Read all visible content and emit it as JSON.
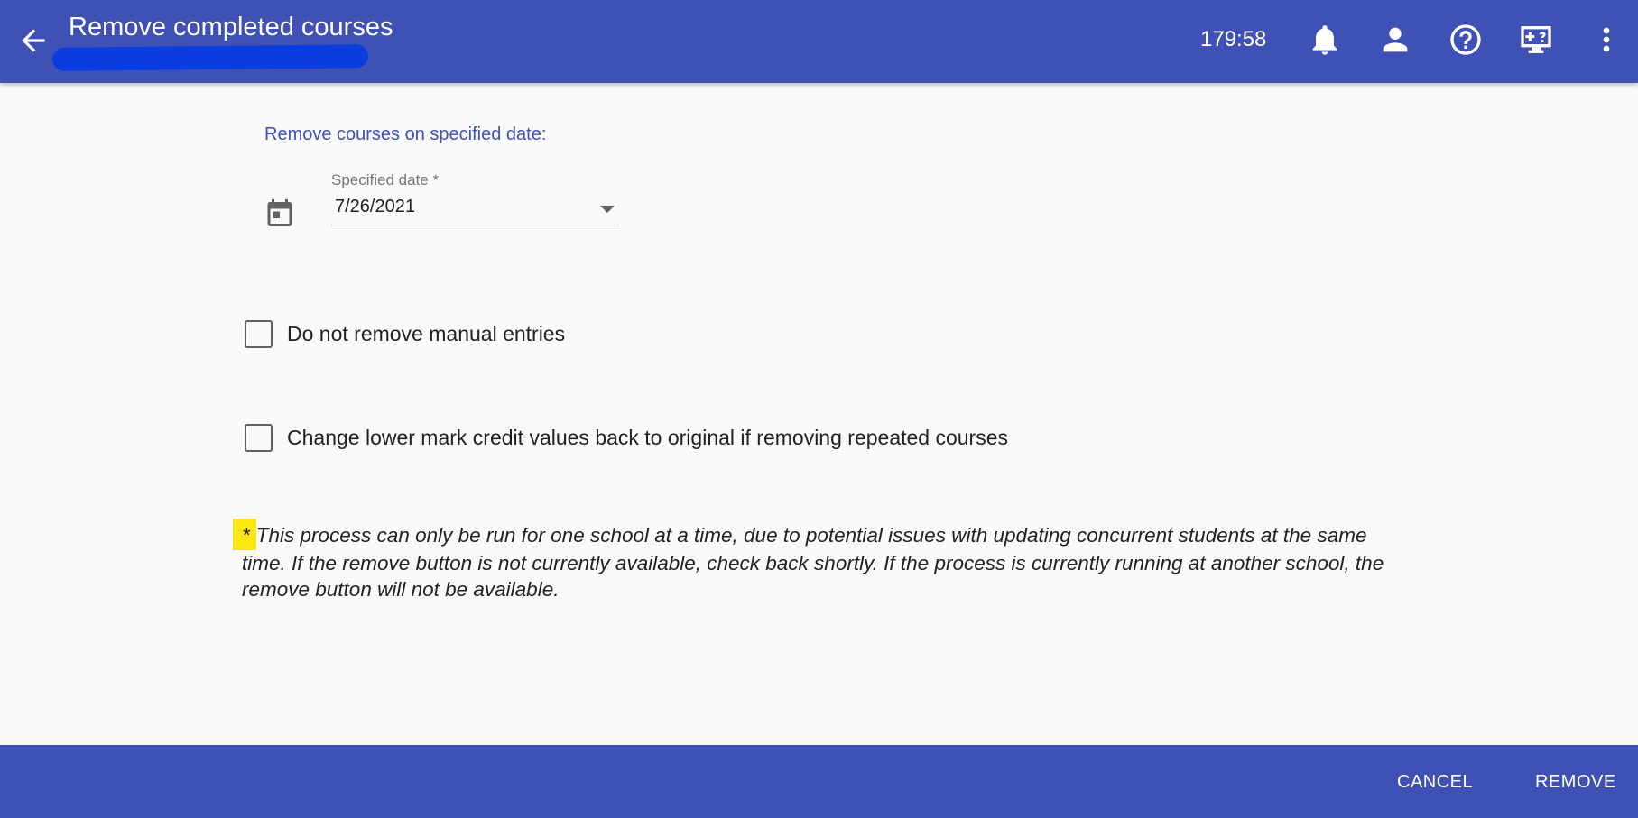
{
  "header": {
    "title": "Remove completed courses",
    "timer": "179:58",
    "icons": [
      "back-arrow-icon",
      "bell-icon",
      "person-icon",
      "help-circle-icon",
      "screen-help-icon",
      "more-vert-icon"
    ]
  },
  "form": {
    "section_label": "Remove courses on specified date:",
    "date_field": {
      "label": "Specified date *",
      "value": "7/26/2021"
    },
    "checkboxes": [
      {
        "label": "Do not remove manual entries",
        "checked": false
      },
      {
        "label": "Change lower mark credit values back to original if removing repeated courses",
        "checked": false
      }
    ],
    "note": {
      "asterisk": "*",
      "text": "This process can only be run for one school at a time, due to potential issues with updating concurrent students at the same time. If the remove button is not currently available, check back shortly. If the process is currently running at another school, the remove button will not be available."
    }
  },
  "footer": {
    "cancel_label": "CANCEL",
    "remove_label": "REMOVE"
  },
  "colors": {
    "primary": "#3f51b5",
    "background": "#fafafa",
    "highlight": "#fbe614"
  }
}
